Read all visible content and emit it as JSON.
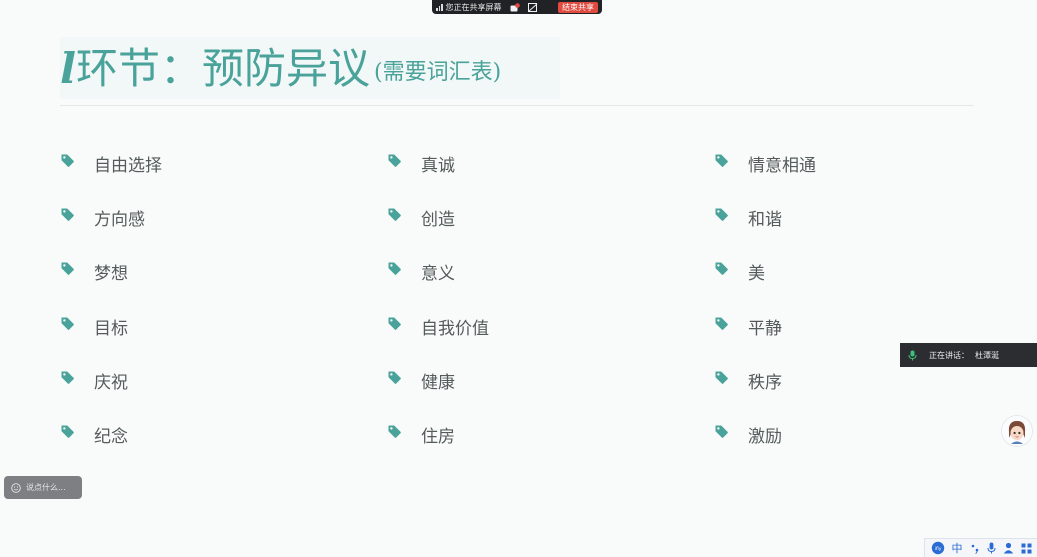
{
  "share_bar": {
    "status": "您正在共享屏幕",
    "stop_label": "结束共享"
  },
  "slide": {
    "title_lead": "l",
    "title_main": "环节：预防异议",
    "title_sub": "(需要词汇表)",
    "columns": [
      [
        "自由选择",
        "方向感",
        "梦想",
        "目标",
        "庆祝",
        "纪念"
      ],
      [
        "真诚",
        "创造",
        "意义",
        "自我价值",
        "健康",
        "住房"
      ],
      [
        "情意相通",
        "和谐",
        "美",
        "平静",
        "秩序",
        "激励"
      ]
    ],
    "tag_icon": "tag-icon",
    "accent": "#4aa39a"
  },
  "speaking": {
    "label": "正在讲话：",
    "name": "杜潭涎"
  },
  "comment": {
    "placeholder": "说点什么..."
  },
  "ime": {
    "brand": "ifly",
    "lang": "中",
    "icons": [
      "punctuation-icon",
      "mic-icon",
      "user-icon",
      "grid-icon"
    ]
  }
}
